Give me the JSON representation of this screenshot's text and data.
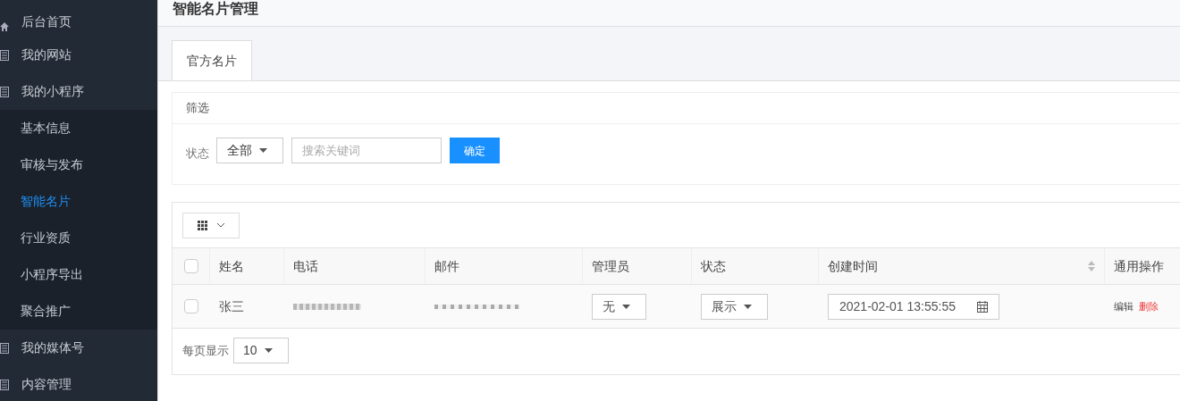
{
  "sidebar": {
    "items": [
      {
        "label": "后台首页"
      },
      {
        "label": "我的网站"
      },
      {
        "label": "我的小程序",
        "children": [
          {
            "label": "基本信息",
            "selected": false
          },
          {
            "label": "审核与发布",
            "selected": false
          },
          {
            "label": "智能名片",
            "selected": true
          },
          {
            "label": "行业资质",
            "selected": false
          },
          {
            "label": "小程序导出",
            "selected": false
          },
          {
            "label": "聚合推广",
            "selected": false
          }
        ]
      },
      {
        "label": "我的媒体号"
      },
      {
        "label": "内容管理"
      }
    ]
  },
  "page_title": "智能名片管理",
  "tabs": [
    {
      "label": "官方名片",
      "selected": true
    }
  ],
  "filter": {
    "title": "筛选",
    "status_label": "状态",
    "status_value": "全部",
    "search": {
      "placeholder": "搜索关键词"
    },
    "submit": "确定"
  },
  "table": {
    "columns": [
      "姓名",
      "电话",
      "邮件",
      "管理员",
      "状态",
      "创建时间",
      "通用操作"
    ],
    "rows": [
      {
        "checked": false,
        "name": "张三",
        "admin": "无",
        "status": "展示",
        "created": "2021-02-01 13:55:55",
        "actions": [
          "编辑",
          "删除"
        ]
      }
    ]
  },
  "header_checked": false,
  "pagination": {
    "label": "每页显示",
    "page_size": "10"
  }
}
